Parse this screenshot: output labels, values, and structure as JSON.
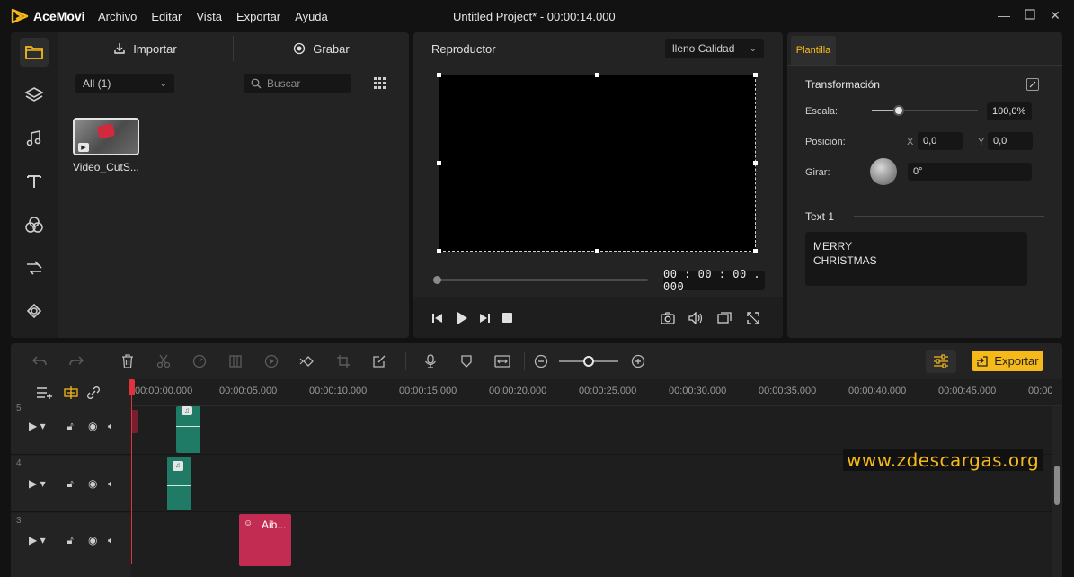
{
  "app": {
    "name": "AceMovi",
    "window_title": "Untitled Project* - 00:00:14.000"
  },
  "menu": [
    "Archivo",
    "Editar",
    "Vista",
    "Exportar",
    "Ayuda"
  ],
  "media": {
    "import_label": "Importar",
    "record_label": "Grabar",
    "filter_value": "All (1)",
    "search_placeholder": "Buscar",
    "items": [
      {
        "name": "Video_CutS..."
      }
    ]
  },
  "player": {
    "title": "Reproductor",
    "quality": "lleno Calidad",
    "timecode": "00 : 00 : 00 . 000",
    "progress": 0
  },
  "properties": {
    "tab": "Plantilla",
    "section_transform": "Transformación",
    "scale_label": "Escala:",
    "scale_value": "100,0%",
    "scale_level": 0.25,
    "position_label": "Posición:",
    "x_label": "X",
    "x_value": "0,0",
    "y_label": "Y",
    "y_value": "0,0",
    "rotate_label": "Girar:",
    "rotate_value": "0°",
    "text_section": "Text 1",
    "text_line1": "MERRY",
    "text_line2": "CHRISTMAS"
  },
  "toolbar": {
    "export_label": "Exportar",
    "zoom_level": 0.5
  },
  "timeline": {
    "ruler": [
      "00:00:00.000",
      "00:00:05.000",
      "00:00:10.000",
      "00:00:15.000",
      "00:00:20.000",
      "00:00:25.000",
      "00:00:30.000",
      "00:00:35.000",
      "00:00:40.000",
      "00:00:45.000",
      "00:00"
    ],
    "tracks": [
      {
        "number": "5"
      },
      {
        "number": "4"
      },
      {
        "number": "3"
      }
    ],
    "text_clip_label": "Aib..."
  },
  "watermark": "www.zdescargas.org",
  "colors": {
    "accent": "#f5b919",
    "audio_clip": "#1f7a66",
    "text_clip": "#c22c52",
    "playhead": "#e0323c"
  }
}
